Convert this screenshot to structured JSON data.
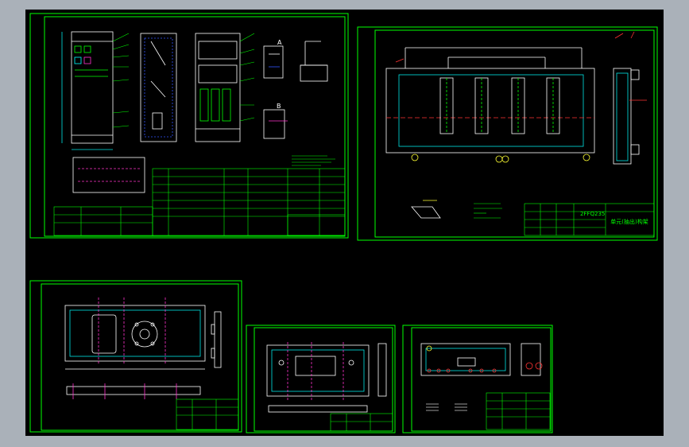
{
  "colors": {
    "background": "#aab1b9",
    "canvas": "#000000",
    "frame": "#00ff00",
    "drawing": "#ffffff",
    "dimension": "#00e5e5",
    "accent_magenta": "#ff33cc",
    "accent_red": "#ff3333",
    "accent_yellow": "#ffff33",
    "accent_blue": "#3355ff"
  },
  "sheets": [
    {
      "id": "sheet-1",
      "title_block": {
        "name": ""
      }
    },
    {
      "id": "sheet-2",
      "title_block": {
        "code": "2FFQ235",
        "name": "单元(抽出)构架"
      }
    },
    {
      "id": "sheet-3",
      "title_block": {
        "name": ""
      }
    },
    {
      "id": "sheet-4",
      "title_block": {
        "name": ""
      }
    },
    {
      "id": "sheet-5",
      "title_block": {
        "name": ""
      }
    }
  ],
  "annotations": {
    "section_a": "A",
    "section_b": "B"
  }
}
